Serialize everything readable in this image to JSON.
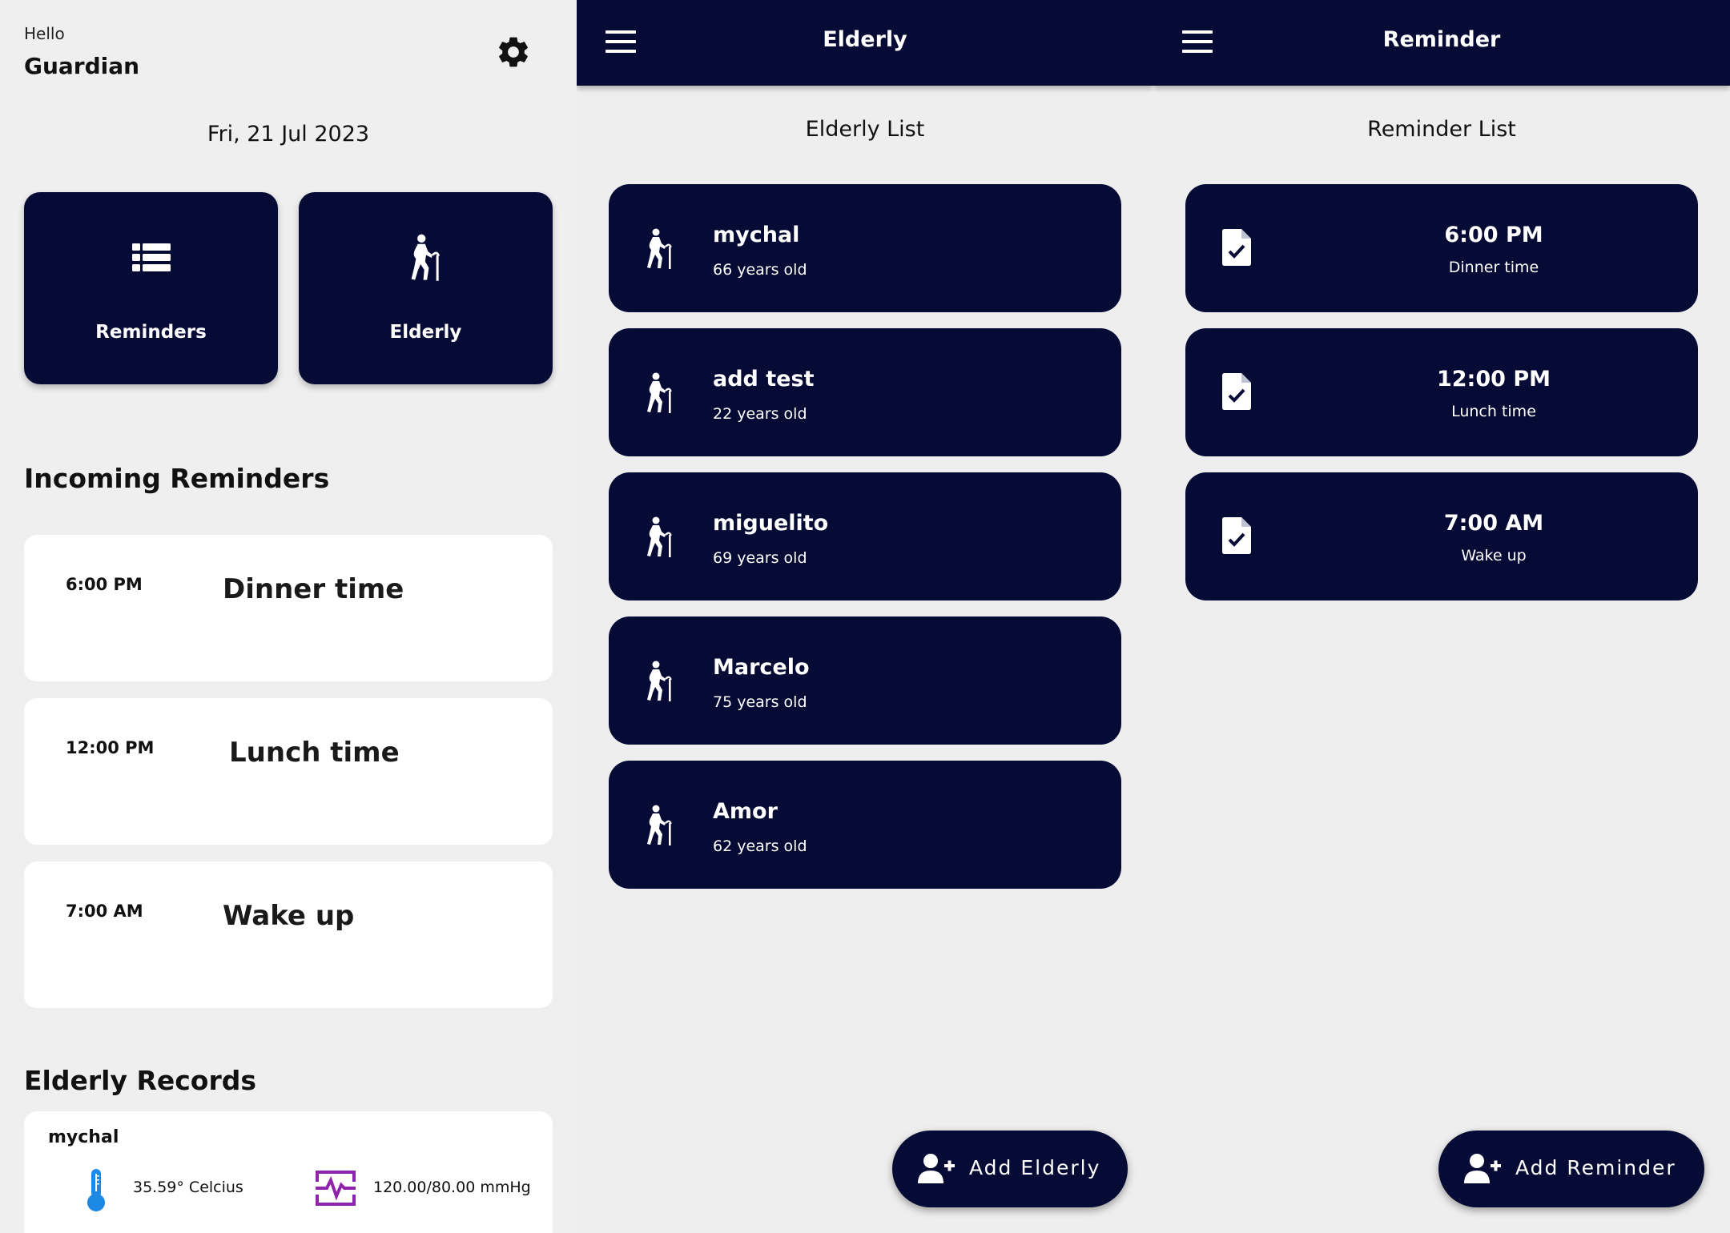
{
  "home": {
    "greeting": "Hello",
    "user_name": "Guardian",
    "date": "Fri, 21 Jul 2023",
    "tiles": [
      {
        "label": "Reminders",
        "icon": "list-icon"
      },
      {
        "label": "Elderly",
        "icon": "elderly-walker-icon"
      }
    ],
    "incoming_title": "Incoming Reminders",
    "incoming": [
      {
        "time": "6:00 PM",
        "name": "Dinner time"
      },
      {
        "time": "12:00 PM",
        "name": "Lunch time"
      },
      {
        "time": "7:00 AM",
        "name": "Wake up"
      }
    ],
    "records_title": "Elderly Records",
    "record": {
      "name": "mychal",
      "temperature": "35.59° Celcius",
      "blood_pressure": "120.00/80.00 mmHg"
    }
  },
  "elderly_screen": {
    "title": "Elderly",
    "list_title": "Elderly List",
    "items": [
      {
        "name": "mychal",
        "age": "66 years old"
      },
      {
        "name": "add test",
        "age": "22 years old"
      },
      {
        "name": "miguelito",
        "age": "69 years old"
      },
      {
        "name": "Marcelo",
        "age": "75 years old"
      },
      {
        "name": "Amor",
        "age": "62 years old"
      }
    ],
    "fab_label": "Add Elderly"
  },
  "reminder_screen": {
    "title": "Reminder",
    "list_title": "Reminder List",
    "items": [
      {
        "time": "6:00 PM",
        "label": "Dinner time"
      },
      {
        "time": "12:00 PM",
        "label": "Lunch time"
      },
      {
        "time": "7:00 AM",
        "label": "Wake up"
      }
    ],
    "fab_label": "Add Reminder"
  },
  "colors": {
    "navy": "#050b35",
    "background": "#eeeeee",
    "thermometer": "#1e88e5",
    "pulse": "#8e24aa"
  }
}
